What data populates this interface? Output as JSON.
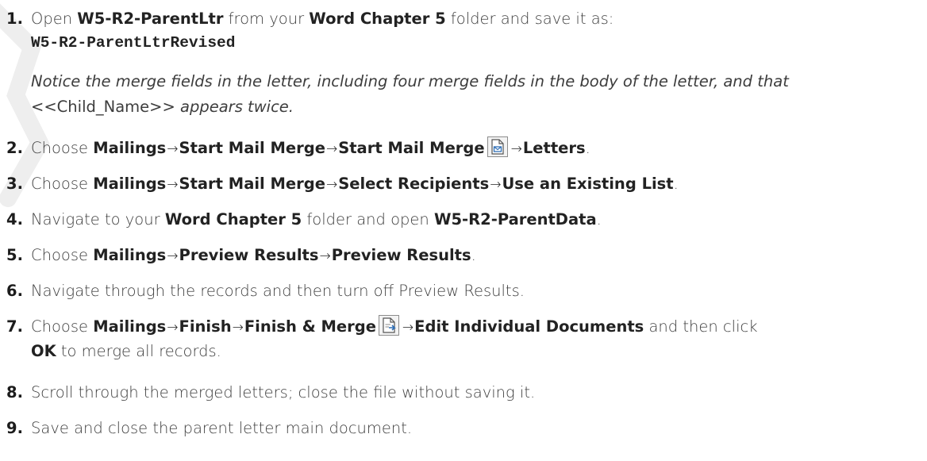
{
  "steps": [
    {
      "num": "1.",
      "text_a": "Open ",
      "bold_a": "W5-R2-ParentLtr",
      "text_b": " from your ",
      "bold_b": "Word Chapter 5",
      "text_c": " folder and save it as:",
      "code": "W5-R2-ParentLtrRevised",
      "note_line1": "Notice the merge fields in the letter, including four merge fields in the body of the letter, and that",
      "note_field": "<<Child_Name>>",
      "note_line2_tail": " appears twice."
    },
    {
      "num": "2.",
      "text_a": "Choose ",
      "path": [
        "Mailings",
        "Start Mail Merge",
        "Start Mail Merge"
      ],
      "icon": "start-mail-merge-icon",
      "after_icon": "Letters",
      "end": "."
    },
    {
      "num": "3.",
      "text_a": "Choose ",
      "path": [
        "Mailings",
        "Start Mail Merge",
        "Select Recipients",
        "Use an Existing List"
      ],
      "end": "."
    },
    {
      "num": "4.",
      "text_a": "Navigate to your ",
      "bold_a": "Word Chapter 5",
      "text_b": " folder and open ",
      "bold_b": "W5-R2-ParentData",
      "end": "."
    },
    {
      "num": "5.",
      "text_a": "Choose ",
      "path": [
        "Mailings",
        "Preview Results",
        "Preview Results"
      ],
      "end": "."
    },
    {
      "num": "6.",
      "text_a": "Navigate through the records and then turn off Preview Results."
    },
    {
      "num": "7.",
      "text_a": "Choose ",
      "path": [
        "Mailings",
        "Finish",
        "Finish & Merge"
      ],
      "icon": "finish-merge-icon",
      "after_icon": "Edit Individual Documents",
      "text_b": " and then click",
      "bold_b": "OK",
      "text_c": " to merge all records."
    },
    {
      "num": "8.",
      "text_a": "Scroll through the merged letters; close the file without saving it."
    },
    {
      "num": "9.",
      "text_a": "Save and close the parent letter main document."
    }
  ],
  "arrow": "→"
}
